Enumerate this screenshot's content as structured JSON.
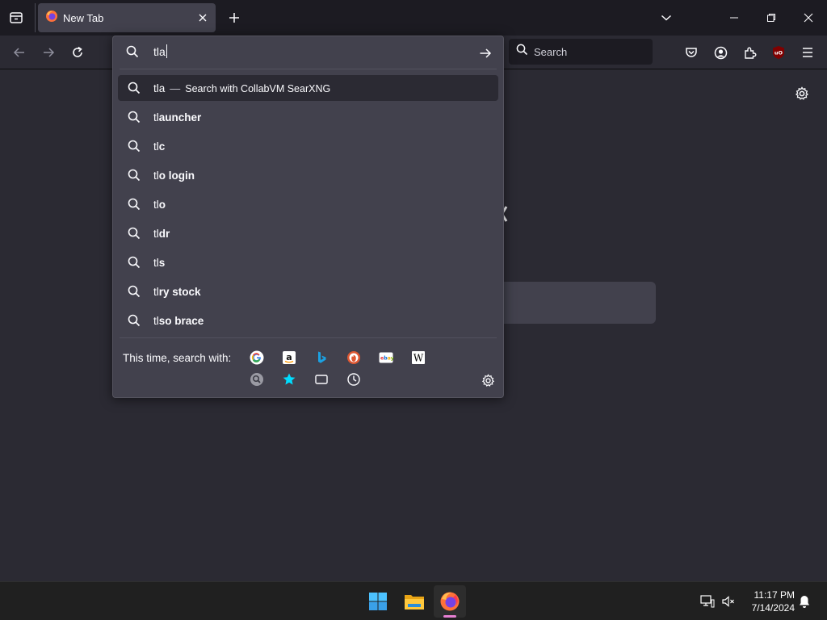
{
  "tab": {
    "title": "New Tab"
  },
  "toolbar": {
    "search_placeholder": "Search"
  },
  "urlbar": {
    "input_value": "tla",
    "results": [
      {
        "typed": "tla",
        "completion": "",
        "action": "Search with CollabVM SearXNG",
        "selected": true
      },
      {
        "typed": "tl",
        "completion": "auncher"
      },
      {
        "typed": "tl",
        "completion": "c"
      },
      {
        "typed": "tl",
        "completion": "o login"
      },
      {
        "typed": "tl",
        "completion": "o"
      },
      {
        "typed": "tl",
        "completion": "dr"
      },
      {
        "typed": "tl",
        "completion": "s"
      },
      {
        "typed": "tl",
        "completion": "ry stock"
      },
      {
        "typed": "tl",
        "completion": "so brace"
      }
    ],
    "dash": "—",
    "oneoff_label": "This time, search with:",
    "engines": [
      "google-icon",
      "amazon-icon",
      "bing-icon",
      "duckduckgo-icon",
      "ebay-icon",
      "wikipedia-icon",
      "searxng-icon",
      "bookmarks-icon",
      "tabs-icon",
      "history-icon"
    ]
  },
  "taskbar": {
    "time": "11:17 PM",
    "date": "7/14/2024"
  },
  "colors": {
    "accent": "#00ddff",
    "firefox_indicator": "#e67fd2"
  }
}
